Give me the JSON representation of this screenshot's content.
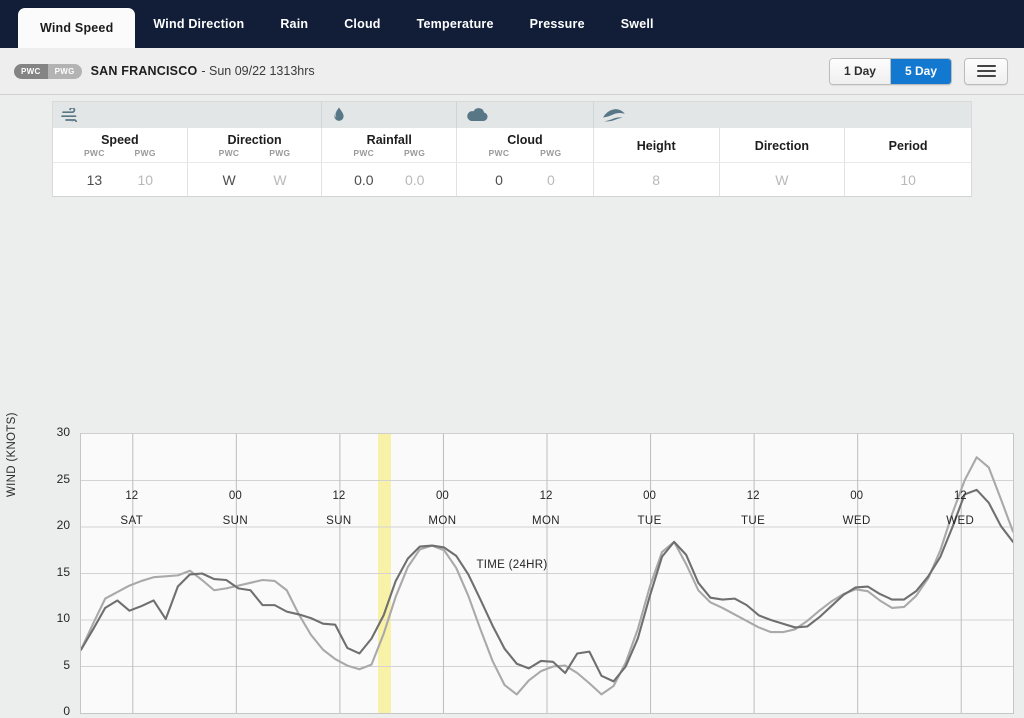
{
  "tabs": [
    {
      "label": "Wind Speed",
      "active": true
    },
    {
      "label": "Wind Direction",
      "active": false
    },
    {
      "label": "Rain",
      "active": false
    },
    {
      "label": "Cloud",
      "active": false
    },
    {
      "label": "Temperature",
      "active": false
    },
    {
      "label": "Pressure",
      "active": false
    },
    {
      "label": "Swell",
      "active": false
    }
  ],
  "location": {
    "badge_pwc": "PWC",
    "badge_pwg": "PWG",
    "name": "SAN FRANCISCO",
    "timestamp": "- Sun 09/22 1313hrs"
  },
  "controls": {
    "one_day": "1 Day",
    "five_day": "5 Day",
    "selected": "5 Day",
    "menu_icon": "hamburger-menu-icon",
    "accent_color": "#1278d0"
  },
  "summary_table": {
    "groups": [
      {
        "icon": "wind-icon",
        "label": "wind"
      },
      {
        "icon": "raindrop-icon",
        "label": "rain"
      },
      {
        "icon": "cloud-icon",
        "label": "cloud"
      },
      {
        "icon": "swell-wave-icon",
        "label": "swell"
      }
    ],
    "columns": [
      {
        "label": "Speed",
        "sub": [
          "PWC",
          "PWG"
        ],
        "values": [
          "13",
          "10"
        ],
        "dim": [
          false,
          true
        ]
      },
      {
        "label": "Direction",
        "sub": [
          "PWC",
          "PWG"
        ],
        "values": [
          "W",
          "W"
        ],
        "dim": [
          false,
          true
        ]
      },
      {
        "label": "Rainfall",
        "sub": [
          "PWC",
          "PWG"
        ],
        "values": [
          "0.0",
          "0.0"
        ],
        "dim": [
          false,
          true
        ]
      },
      {
        "label": "Cloud",
        "sub": [
          "PWC",
          "PWG"
        ],
        "values": [
          "0",
          "0"
        ],
        "dim": [
          false,
          true
        ]
      },
      {
        "label": "Height",
        "sub": [],
        "values": [
          "8"
        ],
        "dim": [
          true
        ]
      },
      {
        "label": "Direction",
        "sub": [],
        "values": [
          "W"
        ],
        "dim": [
          true
        ]
      },
      {
        "label": "Period",
        "sub": [],
        "values": [
          "10"
        ],
        "dim": [
          true
        ]
      }
    ]
  },
  "chart_data": {
    "type": "line",
    "title": "",
    "xlabel": "TIME (24HR)",
    "ylabel": "WIND (KNOTS)",
    "ylim": [
      0,
      30
    ],
    "yticks": [
      0,
      5,
      10,
      15,
      20,
      25,
      30
    ],
    "grid": true,
    "legend": "none",
    "now_marker": {
      "label": "Sun 09/22 1313hrs",
      "x_index": 25,
      "color": "#f7f09a"
    },
    "xticks": [
      {
        "hour": "12",
        "day": "SAT"
      },
      {
        "hour": "00",
        "day": "SUN"
      },
      {
        "hour": "12",
        "day": "SUN"
      },
      {
        "hour": "00",
        "day": "MON"
      },
      {
        "hour": "12",
        "day": "MON"
      },
      {
        "hour": "00",
        "day": "TUE"
      },
      {
        "hour": "12",
        "day": "TUE"
      },
      {
        "hour": "00",
        "day": "WED"
      },
      {
        "hour": "12",
        "day": "WED"
      }
    ],
    "x_hours": [
      0,
      1,
      2,
      3,
      4,
      5,
      6,
      7,
      8,
      9,
      10,
      11,
      12,
      13,
      14,
      15,
      16,
      17,
      18,
      19,
      20,
      21,
      22,
      23,
      24,
      25,
      26,
      27,
      28,
      29,
      30,
      31,
      32,
      33,
      34,
      35,
      36,
      37,
      38,
      39,
      40,
      41,
      42,
      43,
      44,
      45,
      46,
      47,
      48,
      49,
      50,
      51,
      52,
      53,
      54,
      55,
      56,
      57,
      58,
      59,
      60,
      61,
      62,
      63,
      64,
      65,
      66,
      67,
      68,
      69,
      70,
      71,
      72,
      73,
      74,
      75,
      76,
      77
    ],
    "series": [
      {
        "name": "PWC",
        "color": "#6f6f6f",
        "values": [
          6.8,
          9.0,
          11.3,
          12.1,
          11.0,
          11.5,
          12.1,
          10.1,
          13.6,
          14.9,
          15.0,
          14.4,
          14.3,
          13.4,
          13.2,
          11.6,
          11.6,
          10.9,
          10.6,
          10.2,
          9.6,
          9.5,
          7.0,
          6.4,
          8.0,
          10.5,
          14.2,
          16.6,
          17.9,
          18.0,
          17.8,
          16.9,
          14.9,
          12.2,
          9.4,
          6.9,
          5.3,
          4.8,
          5.6,
          5.5,
          4.3,
          6.4,
          6.6,
          4.0,
          3.4,
          5.0,
          8.0,
          12.6,
          16.8,
          18.4,
          17.0,
          14.0,
          12.4,
          12.2,
          12.3,
          11.6,
          10.5,
          10.0,
          9.6,
          9.2,
          9.3,
          10.3,
          11.5,
          12.7,
          13.5,
          13.6,
          12.8,
          12.2,
          12.2,
          13.1,
          14.7,
          16.8,
          20.0,
          23.5,
          24.0,
          22.6,
          20.1,
          18.4
        ]
      },
      {
        "name": "PWG",
        "color": "#a9a9a9",
        "values": [
          6.8,
          9.6,
          12.3,
          13.0,
          13.7,
          14.2,
          14.6,
          14.7,
          14.8,
          15.3,
          14.3,
          13.2,
          13.4,
          13.7,
          14.0,
          14.3,
          14.2,
          13.2,
          10.6,
          8.4,
          6.8,
          5.8,
          5.1,
          4.7,
          5.2,
          8.5,
          12.5,
          15.7,
          17.6,
          18.0,
          17.5,
          15.6,
          12.6,
          9.0,
          5.6,
          3.0,
          2.0,
          3.5,
          4.5,
          5.0,
          5.1,
          4.3,
          3.2,
          2.0,
          2.9,
          5.4,
          9.0,
          13.6,
          17.3,
          18.4,
          16.0,
          13.2,
          11.9,
          11.3,
          10.6,
          9.9,
          9.2,
          8.7,
          8.7,
          9.0,
          9.9,
          11.0,
          12.0,
          12.8,
          13.3,
          13.1,
          12.1,
          11.3,
          11.4,
          12.6,
          14.5,
          17.5,
          21.5,
          25.0,
          27.5,
          26.4,
          23.0,
          19.5
        ]
      }
    ]
  }
}
